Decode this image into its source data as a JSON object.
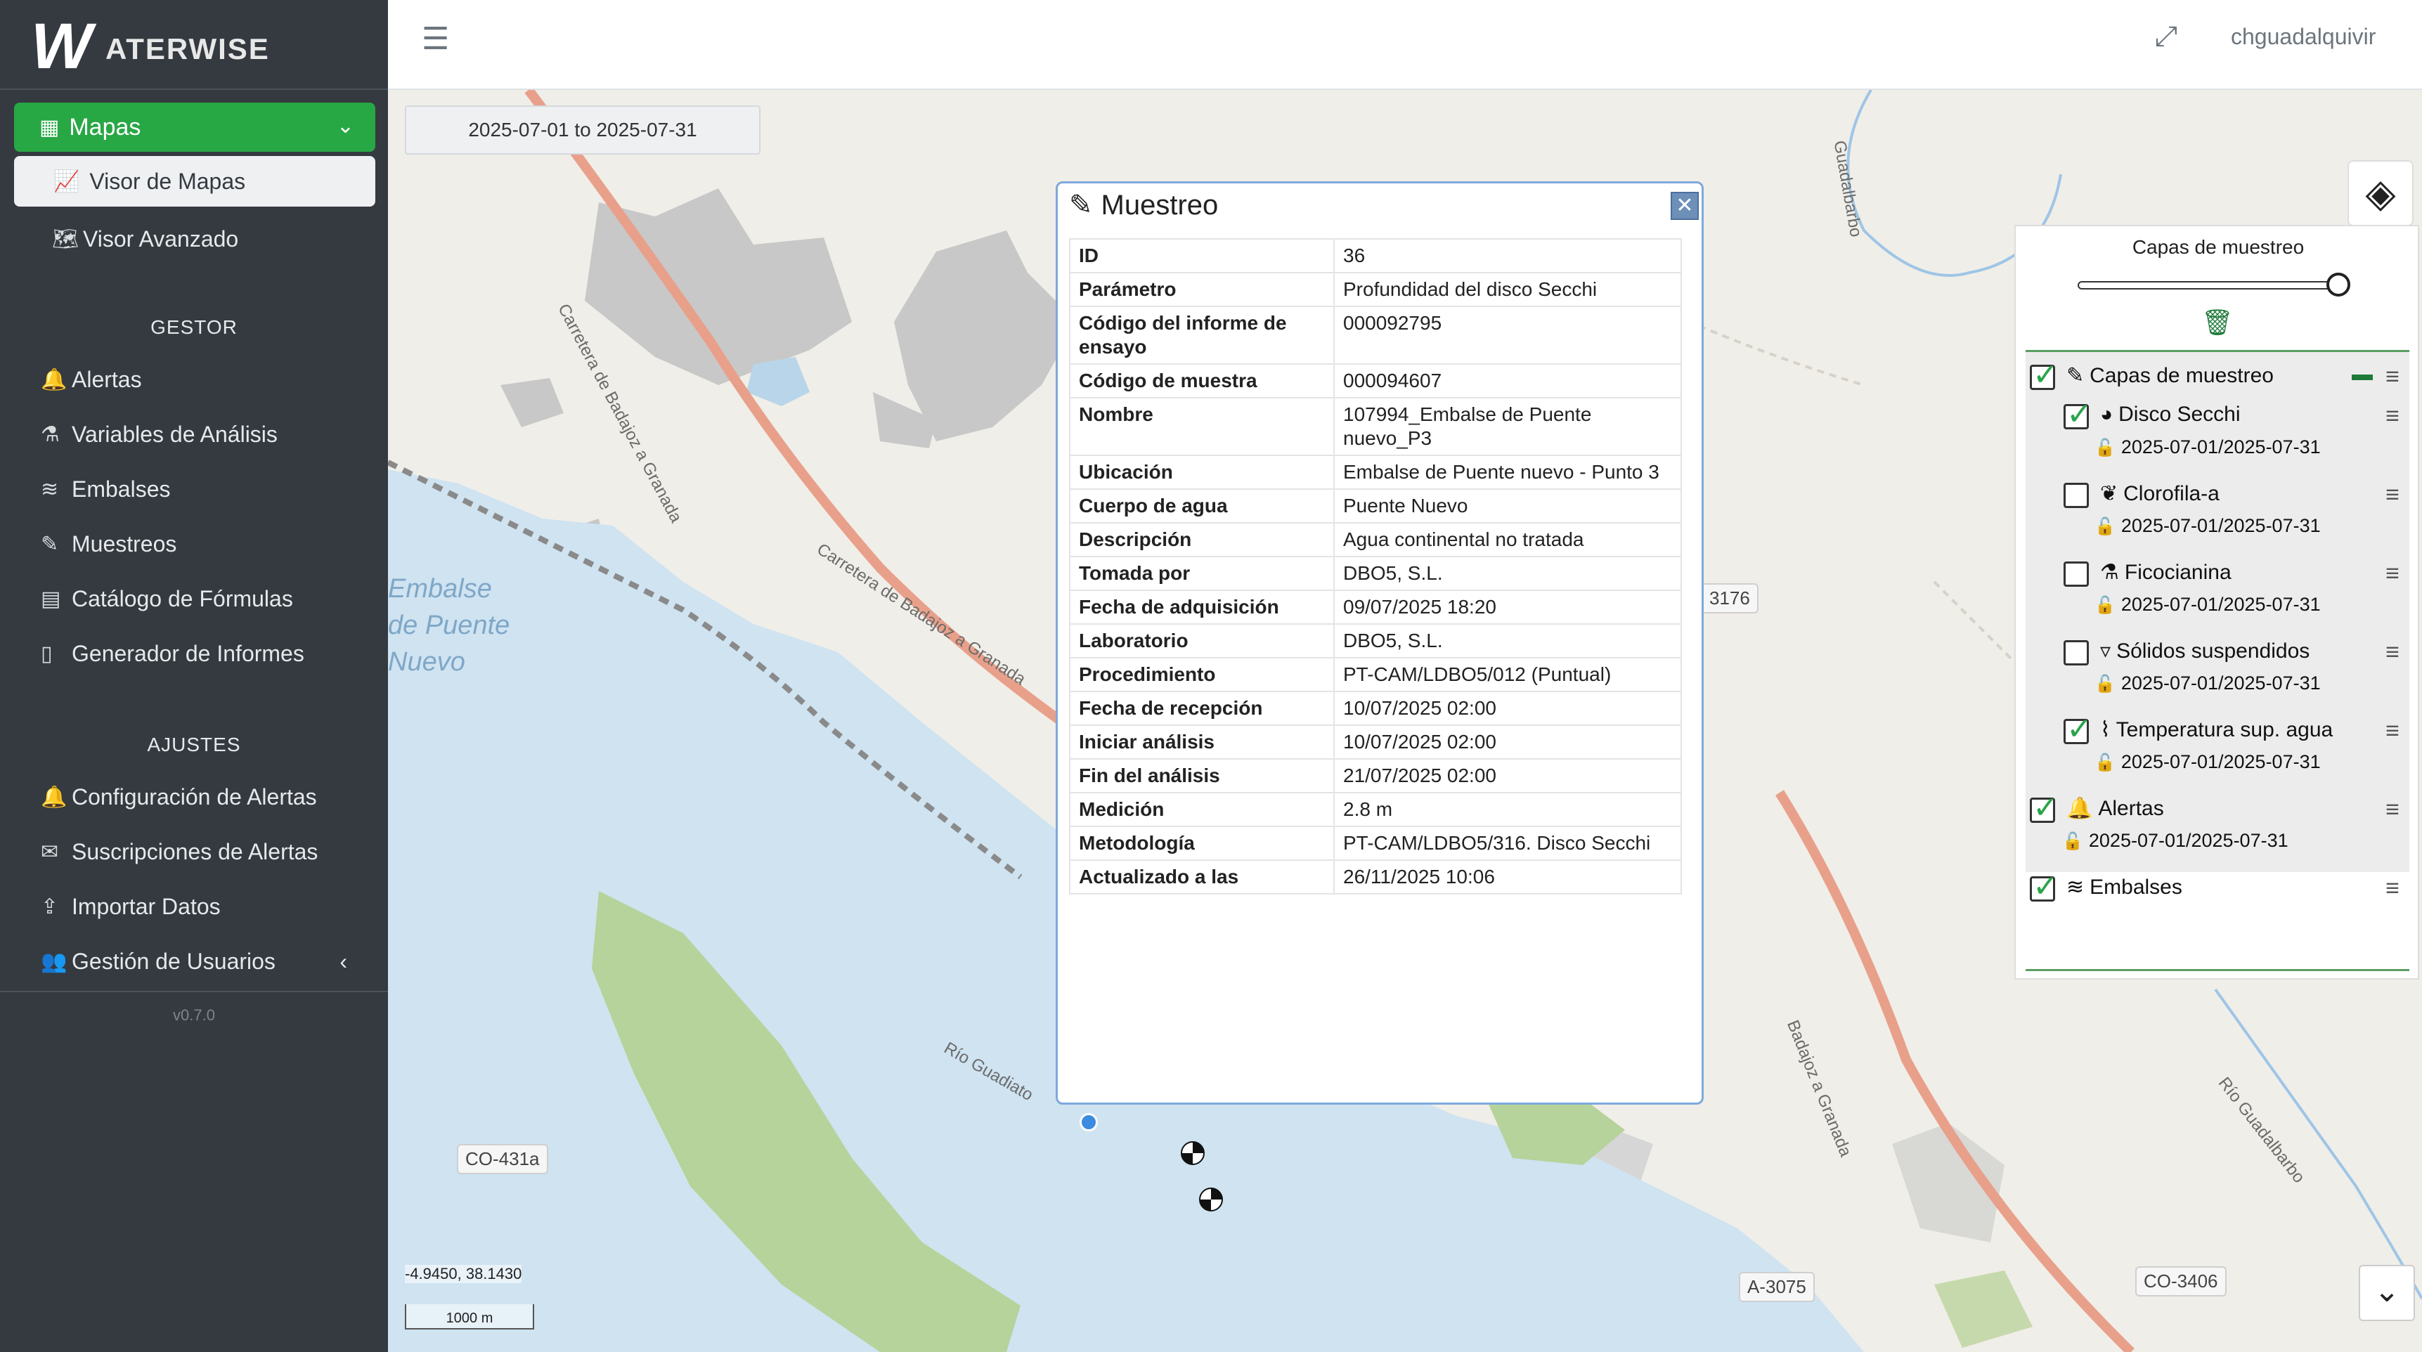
{
  "brand": {
    "logo_mark": "W",
    "logo_text": "ATERWISE"
  },
  "sidebar": {
    "main_menu": {
      "label": "Mapas",
      "icon": "map-icon"
    },
    "map_items": [
      {
        "label": "Visor de Mapas",
        "icon": "chart-line-icon",
        "active": true
      },
      {
        "label": "Visor Avanzado",
        "icon": "map-marked-icon",
        "active": false
      }
    ],
    "sections": [
      {
        "title": "GESTOR",
        "items": [
          {
            "label": "Alertas",
            "icon": "bell-icon"
          },
          {
            "label": "Variables de Análisis",
            "icon": "flask-icon"
          },
          {
            "label": "Embalses",
            "icon": "water-icon"
          },
          {
            "label": "Muestreos",
            "icon": "pencil-icon"
          },
          {
            "label": "Catálogo de Fórmulas",
            "icon": "calculator-icon"
          },
          {
            "label": "Generador de Informes",
            "icon": "file-icon"
          }
        ]
      },
      {
        "title": "AJUSTES",
        "items": [
          {
            "label": "Configuración de Alertas",
            "icon": "bell-icon"
          },
          {
            "label": "Suscripciones de Alertas",
            "icon": "envelope-icon"
          },
          {
            "label": "Importar Datos",
            "icon": "upload-icon"
          },
          {
            "label": "Gestión de Usuarios",
            "icon": "users-icon"
          }
        ]
      }
    ],
    "version": "v0.7.0"
  },
  "topbar": {
    "username": "chguadalquivir"
  },
  "map": {
    "date_range": "2025-07-01 to 2025-07-31",
    "coords": "-4.9450, 38.1430",
    "scale": "1000 m",
    "labels": {
      "lake": [
        "Embalse",
        "de Puente",
        "Nuevo"
      ],
      "road_a": "Carretera de Badajoz a Granada",
      "road_b": "Carretera de Badajoz a Granada",
      "river": "Río Guadiato",
      "river2": "Río Guadalbarbo",
      "creek": "Guadalbarbo",
      "shields": [
        "CO-431a",
        "A-3075",
        "CO-3406",
        "3176"
      ]
    }
  },
  "popup": {
    "title": "Muestreo",
    "rows": [
      {
        "k": "ID",
        "v": "36"
      },
      {
        "k": "Parámetro",
        "v": "Profundidad del disco Secchi"
      },
      {
        "k": "Código del informe de ensayo",
        "v": "000092795"
      },
      {
        "k": "Código de muestra",
        "v": "000094607"
      },
      {
        "k": "Nombre",
        "v": "107994_Embalse de Puente nuevo_P3"
      },
      {
        "k": "Ubicación",
        "v": "Embalse de Puente nuevo - Punto 3"
      },
      {
        "k": "Cuerpo de agua",
        "v": "Puente Nuevo"
      },
      {
        "k": "Descripción",
        "v": "Agua continental no tratada"
      },
      {
        "k": "Tomada por",
        "v": "DBO5, S.L."
      },
      {
        "k": "Fecha de adquisición",
        "v": "09/07/2025 18:20"
      },
      {
        "k": "Laboratorio",
        "v": "DBO5, S.L."
      },
      {
        "k": "Procedimiento",
        "v": "PT-CAM/LDBO5/012 (Puntual)"
      },
      {
        "k": "Fecha de recepción",
        "v": "10/07/2025 02:00"
      },
      {
        "k": "Iniciar análisis",
        "v": "10/07/2025 02:00"
      },
      {
        "k": "Fin del análisis",
        "v": "21/07/2025 02:00"
      },
      {
        "k": "Medición",
        "v": "2.8 m"
      },
      {
        "k": "Metodología",
        "v": "PT-CAM/LDBO5/316. Disco Secchi"
      },
      {
        "k": "Actualizado a las",
        "v": "26/11/2025 10:06"
      }
    ]
  },
  "layers": {
    "title": "Capas de muestreo",
    "opacity": 1.0,
    "tree": [
      {
        "label": "Capas de muestreo",
        "checked": true,
        "icon": "pencil-icon",
        "level": 0
      },
      {
        "label": "Disco Secchi",
        "checked": true,
        "icon": "secchi-disk-icon",
        "level": 1,
        "date": "2025-07-01/2025-07-31"
      },
      {
        "label": "Clorofila-a",
        "checked": false,
        "icon": "leaf-icon",
        "level": 1,
        "date": "2025-07-01/2025-07-31"
      },
      {
        "label": "Ficocianina",
        "checked": false,
        "icon": "flask-icon",
        "level": 1,
        "date": "2025-07-01/2025-07-31"
      },
      {
        "label": "Sólidos suspendidos",
        "checked": false,
        "icon": "glass-icon",
        "level": 1,
        "date": "2025-07-01/2025-07-31"
      },
      {
        "label": "Temperatura sup. agua",
        "checked": true,
        "icon": "thermometer-water-icon",
        "level": 1,
        "date": "2025-07-01/2025-07-31"
      },
      {
        "label": "Alertas",
        "checked": true,
        "icon": "bell-icon",
        "level": 0,
        "date": "2025-07-01/2025-07-31"
      },
      {
        "label": "Embalses",
        "checked": true,
        "icon": "water-icon",
        "level": 0
      }
    ]
  },
  "colors": {
    "accent_green": "#28a745",
    "sidebar_bg": "#343a40",
    "lake": "#cfe3f1",
    "forest": "#b5d39a",
    "road": "#e8a08a"
  }
}
